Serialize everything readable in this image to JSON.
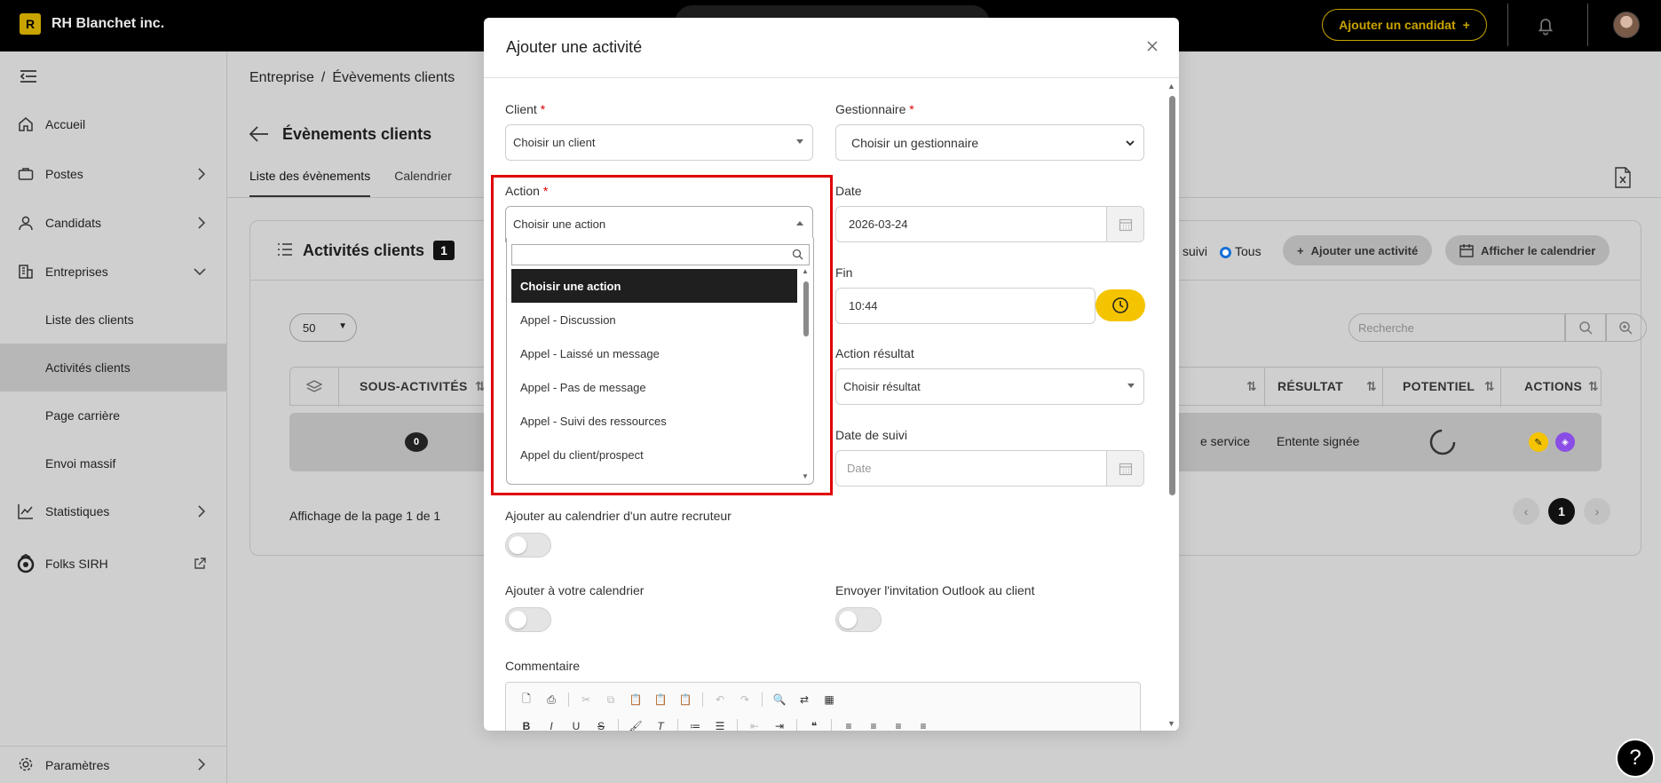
{
  "app": {
    "brand_letter": "R",
    "brand_name": "RH Blanchet inc.",
    "add_candidate_label": "Ajouter un candidat",
    "plus": "+"
  },
  "sidebar": {
    "items": [
      {
        "label": "Accueil",
        "icon": "home-icon"
      },
      {
        "label": "Postes",
        "icon": "briefcase-icon"
      },
      {
        "label": "Candidats",
        "icon": "user-icon"
      },
      {
        "label": "Entreprises",
        "icon": "building-icon"
      },
      {
        "label": "Liste des clients"
      },
      {
        "label": "Activités clients"
      },
      {
        "label": "Page carrière"
      },
      {
        "label": "Envoi massif"
      },
      {
        "label": "Statistiques",
        "icon": "chart-icon"
      },
      {
        "label": "Folks SIRH",
        "icon": "folks-icon"
      },
      {
        "label": "Paramètres",
        "icon": "gear-icon"
      }
    ]
  },
  "page": {
    "breadcrumb_root": "Entreprise",
    "breadcrumb_sep": "/",
    "breadcrumb_current": "Évèvements clients",
    "title": "Évènements clients",
    "tabs": [
      "Liste des évènements",
      "Calendrier"
    ],
    "card_title": "Activités clients",
    "card_count": "1",
    "radio_suivi": "suivi",
    "radio_tous": "Tous",
    "add_activity_btn": "Ajouter une activité",
    "show_calendar_btn": "Afficher le calendrier",
    "page_size": "50",
    "search_placeholder": "Recherche",
    "columns": [
      "SOUS-ACTIVITÉS",
      "RÉSULTAT",
      "POTENTIEL",
      "ACTIONS"
    ],
    "row": {
      "sub_count": "0",
      "service": "e service",
      "result": "Entente signée"
    },
    "paging_text": "Affichage de la page 1 de 1",
    "current_page": "1"
  },
  "modal": {
    "title": "Ajouter une activité",
    "client_label": "Client",
    "client_placeholder": "Choisir un client",
    "manager_label": "Gestionnaire",
    "manager_placeholder": "Choisir un gestionnaire",
    "action_label": "Action",
    "action_value": "Choisir une action",
    "date_label": "Date",
    "date_value": "2026-03-24",
    "end_label": "Fin",
    "end_value": "10:44",
    "result_label": "Action résultat",
    "result_placeholder": "Choisir résultat",
    "followup_label": "Date de suivi",
    "followup_placeholder": "Date",
    "other_calendar_label": "Ajouter au calendrier d'un autre recruteur",
    "own_calendar_label": "Ajouter à votre calendrier",
    "outlook_label": "Envoyer l'invitation Outlook au client",
    "comment_label": "Commentaire",
    "required_mark": "*"
  },
  "dropdown": {
    "options": [
      "Choisir une action",
      "Appel - Discussion",
      "Appel - Laissé un message",
      "Appel - Pas de message",
      "Appel - Suivi des ressources",
      "Appel du client/prospect"
    ],
    "selected_index": 0
  },
  "colors": {
    "accent": "#f5c400",
    "highlight_border": "#e00000",
    "selected_option_bg": "#1f1f1f",
    "radio_blue": "#1570d6"
  }
}
